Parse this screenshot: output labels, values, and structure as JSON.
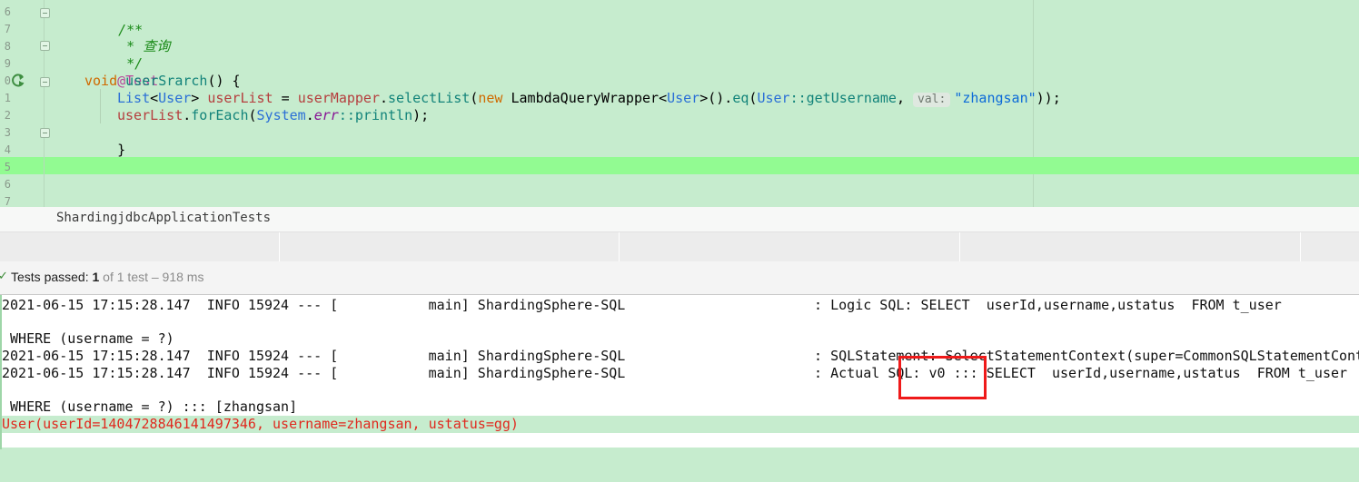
{
  "editor": {
    "line_numbers": [
      "6",
      "7",
      "8",
      "9",
      "0",
      "1",
      "2",
      "3",
      "4",
      "5",
      "6",
      "7"
    ],
    "code": {
      "doc_open": "/**",
      "doc_body": " * 查询",
      "doc_close": " */",
      "annotation": "@Test",
      "kw_void": "void",
      "method_name": "userSrarch",
      "method_sig_rest": "() {",
      "type_list": "List",
      "lt": "<",
      "type_user": "User",
      "gt_space": "> ",
      "var_userlist": "userList",
      "assign": " = ",
      "var_usermapper": "userMapper",
      "dot": ".",
      "method_selectlist": "selectList",
      "open_paren": "(",
      "kw_new": "new",
      "space": " ",
      "type_wrapper": "LambdaQueryWrapper",
      "wrapper_generic": "<",
      "type_user2": "User",
      "wrapper_call": ">().",
      "method_eq": "eq",
      "ref_open": "(",
      "type_user3": "User",
      "ref_getter": "::getUsername",
      "comma": ", ",
      "param_hint": "val:",
      "str_value": "\"zhangsan\"",
      "close_parens": "));",
      "var_userlist2": "userList",
      "dot2": ".",
      "method_foreach": "forEach",
      "foreach_open": "(",
      "type_system": "System",
      "dot3": ".",
      "static_err": "err",
      "ref_println": "::println",
      "foreach_close": ");",
      "close_brace": "}"
    }
  },
  "tabbar": {
    "title": "ShardingjdbcApplicationTests"
  },
  "status": {
    "check_icon": "check-icon",
    "prefix": "Tests passed: ",
    "passed": "1",
    "suffix": " of 1 test – 918 ms"
  },
  "console": {
    "lines": [
      "2021-06-15 17:15:28.147  INFO 15924 --- [           main] ShardingSphere-SQL                       : Logic SQL: SELECT  userId,username,ustatus  FROM t_user",
      "",
      " WHERE (username = ?)",
      "2021-06-15 17:15:28.147  INFO 15924 --- [           main] ShardingSphere-SQL                       : SQLStatement: SelectStatementContext(super=CommonSQLStatementCont",
      "2021-06-15 17:15:28.147  INFO 15924 --- [           main] ShardingSphere-SQL                       : Actual SQL: v0 ::: SELECT  userId,username,ustatus  FROM t_user",
      "",
      " WHERE (username = ?) ::: [zhangsan]"
    ],
    "err_line": "User(userId=1404728846141497346, username=zhangsan, ustatus=gg)"
  },
  "colors": {
    "editor_bg": "#c6ecce",
    "current_line": "#92fb92",
    "annotation_box": "#ef1a1a",
    "error_text": "#e0281e",
    "pass_check": "#3a8a35"
  }
}
